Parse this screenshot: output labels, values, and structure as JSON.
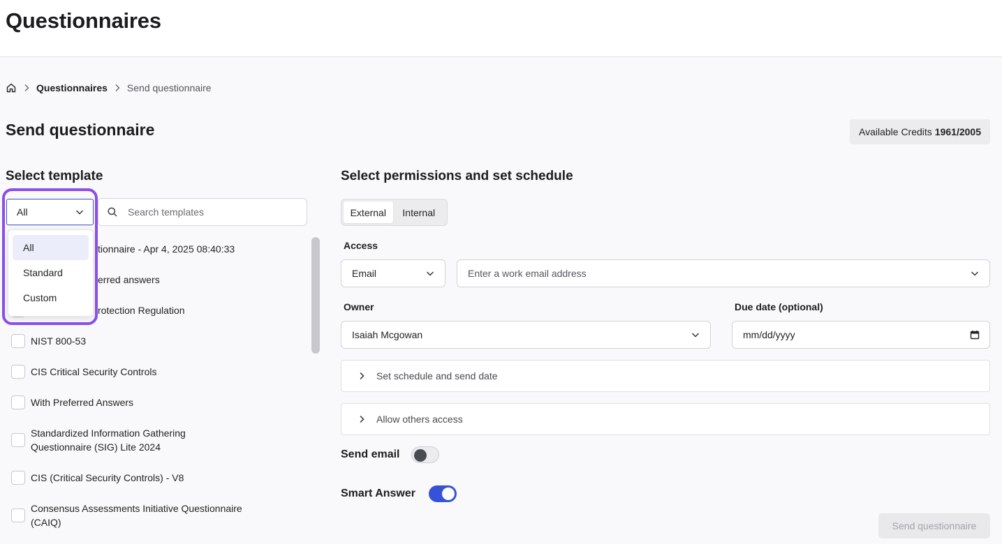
{
  "page": {
    "title": "Questionnaires"
  },
  "breadcrumb": {
    "link": "Questionnaires",
    "current": "Send questionnaire"
  },
  "header": {
    "title": "Send questionnaire",
    "credits_label": "Available Credits",
    "credits_value": "1961/2005"
  },
  "template_panel": {
    "title": "Select template",
    "filter": {
      "selected": "All",
      "options": [
        "All",
        "Standard",
        "Custom"
      ]
    },
    "search_placeholder": "Search templates",
    "templates": [
      {
        "line1": "Questionnaire - Apr 4, 2025 08:40:33",
        "visible_text": "tionnaire - Apr 4, 2025 08:40:33"
      },
      {
        "line1": "With preferred answers",
        "visible_text": "erred answers"
      },
      {
        "line1": "General Data Protection Regulation",
        "visible_text": "rotection Regulation"
      },
      {
        "line1": "NIST 800-53"
      },
      {
        "line1": "CIS Critical Security Controls"
      },
      {
        "line1": "With Preferred Answers"
      },
      {
        "line1": "Standardized Information Gathering",
        "line2": "Questionnaire (SIG) Lite 2024"
      },
      {
        "line1": "CIS (Critical Security Controls) - V8"
      },
      {
        "line1": "Consensus Assessments Initiative Questionnaire",
        "line2": "(CAIQ)"
      }
    ]
  },
  "permissions_panel": {
    "title": "Select permissions and set schedule",
    "tabs": [
      "External",
      "Internal"
    ],
    "active_tab": "External",
    "access_label": "Access",
    "access_type": "Email",
    "email_placeholder": "Enter a work email address",
    "owner_label": "Owner",
    "owner_value": "Isaiah Mcgowan",
    "due_label": "Due date (optional)",
    "due_placeholder": "mm/dd/yyyy",
    "schedule_label": "Set schedule and send date",
    "others_label": "Allow others access",
    "send_email_label": "Send email",
    "send_email_on": false,
    "smart_answer_label": "Smart Answer",
    "smart_answer_on": true,
    "submit_label": "Send questionnaire"
  },
  "colors": {
    "accent": "#3652d9",
    "highlight": "#8a4fe8"
  }
}
